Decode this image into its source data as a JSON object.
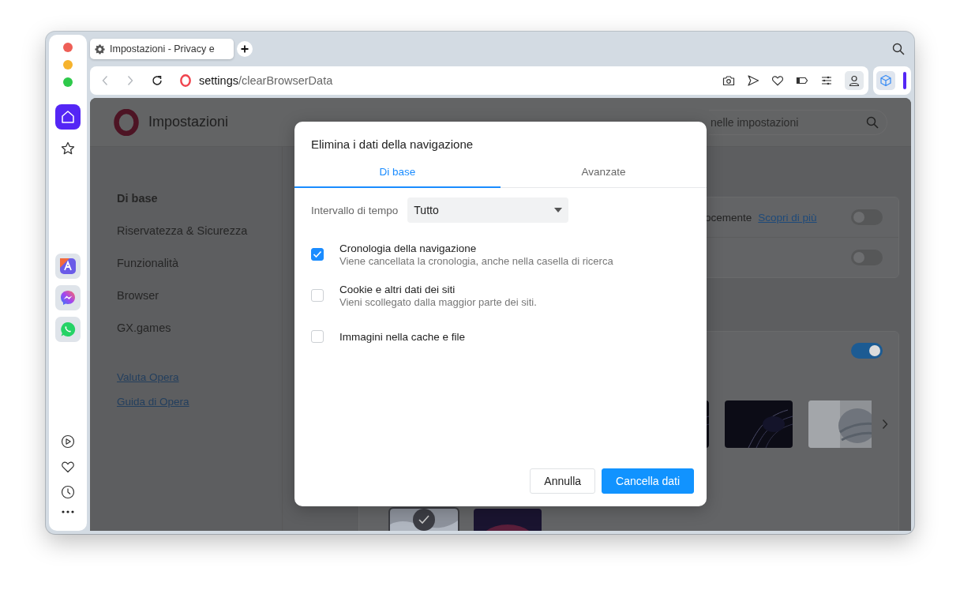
{
  "window": {
    "tabs": [
      {
        "title": "Impostazioni - Privacy e",
        "selected": true
      }
    ],
    "address": {
      "host": "settings",
      "path": "/clearBrowserData"
    }
  },
  "sidebar": {
    "items": [
      {
        "kind": "home",
        "selected": true
      },
      {
        "kind": "bookmarks",
        "selected": false
      }
    ]
  },
  "settings": {
    "title": "Impostazioni",
    "search": {
      "placeholder": "nelle impostazioni"
    },
    "nav": [
      {
        "label": "Di base",
        "selected": true
      },
      {
        "label": "Riservatezza & Sicurezza",
        "selected": false
      },
      {
        "label": "Funzionalità",
        "selected": false
      },
      {
        "label": "Browser",
        "selected": false
      },
      {
        "label": "GX.games",
        "selected": false
      }
    ],
    "links": [
      "Valuta Opera",
      "Guida di Opera"
    ],
    "card_rows": [
      {
        "text": "ocemente",
        "link": "Scopri di più",
        "on": false
      },
      {
        "on": false
      }
    ],
    "wallpaper_card": {
      "on": true,
      "rows": [
        [
          {
            "selected": false
          },
          {
            "selected": false
          },
          {
            "selected": false
          }
        ],
        [
          {
            "selected": true
          },
          {
            "selected": false
          }
        ]
      ]
    }
  },
  "dialog": {
    "title": "Elimina i dati della navigazione",
    "tabs": [
      {
        "label": "Di base",
        "selected": true
      },
      {
        "label": "Avanzate",
        "selected": false
      }
    ],
    "time_range": {
      "label": "Intervallo di tempo",
      "value": "Tutto"
    },
    "options": [
      {
        "label": "Cronologia della navigazione",
        "description": "Viene cancellata la cronologia, anche nella casella di ricerca",
        "checked": true
      },
      {
        "label": "Cookie e altri dati dei siti",
        "description": "Vieni scollegato dalla maggior parte dei siti.",
        "checked": false
      },
      {
        "label": "Immagini nella cache e file",
        "checked": false
      }
    ],
    "buttons": [
      {
        "label": "Annulla",
        "kind": "secondary"
      },
      {
        "label": "Cancella dati",
        "kind": "primary"
      }
    ]
  }
}
